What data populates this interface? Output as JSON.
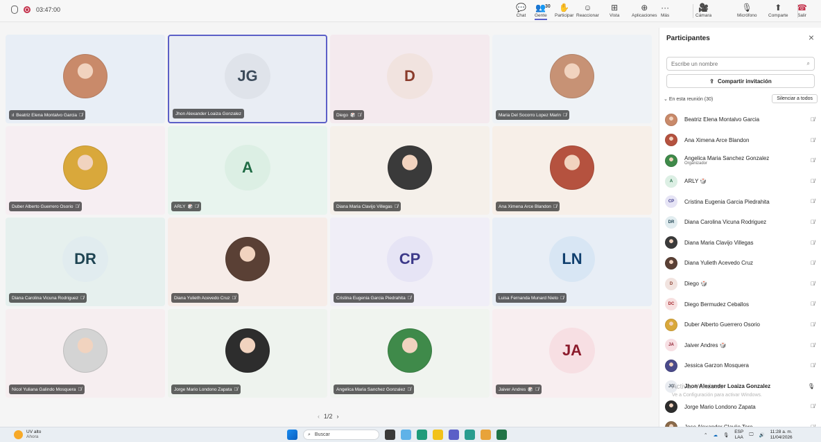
{
  "topbar": {
    "timer": "03:47:00",
    "buttons": [
      {
        "label": "Chat",
        "icon": "chat-icon",
        "glyph": "💬"
      },
      {
        "label": "Gente",
        "icon": "people-icon",
        "glyph": "👥",
        "count": "30"
      },
      {
        "label": "Participar",
        "icon": "raise-hand-icon",
        "glyph": "✋"
      },
      {
        "label": "Reaccionar",
        "icon": "smiley-icon",
        "glyph": "☺"
      },
      {
        "label": "Vista",
        "icon": "grid-view-icon",
        "glyph": "⊞"
      },
      {
        "label": "Aplicaciones",
        "icon": "add-app-icon",
        "glyph": "⊕"
      },
      {
        "label": "Más",
        "icon": "more-icon",
        "glyph": "···"
      },
      {
        "label": "Cámara",
        "icon": "camera-off-icon",
        "glyph": "🎥"
      },
      {
        "label": "Micrófono",
        "icon": "mic-off-icon",
        "glyph": "🎙"
      },
      {
        "label": "Comparte",
        "icon": "share-icon",
        "glyph": "⬆"
      },
      {
        "label": "Salir",
        "icon": "hang-up-icon",
        "glyph": "☎"
      }
    ]
  },
  "stage": {
    "tiles": [
      {
        "name": "Beatriz Elena Montalvo Garcia",
        "initials": "",
        "photo_color": "#c98a6a",
        "bg": "#e8eef6",
        "speaking": true,
        "muted": true
      },
      {
        "name": "Jhon Alexander Loaiza Gonzalez",
        "initials": "JG",
        "avatar_bg": "#dfe3ea",
        "avatar_fg": "#3b4a5a",
        "bg": "#e9edf4",
        "selected": true,
        "muted": false
      },
      {
        "name": "Diego",
        "initials": "D",
        "avatar_bg": "#f1e3df",
        "avatar_fg": "#8a3c2c",
        "bg": "#f4eaee",
        "hand": true,
        "muted": true
      },
      {
        "name": "Maria Del Socorro Lopez Marin",
        "initials": "",
        "photo_color": "#c79275",
        "bg": "#eef2f6",
        "muted": true
      },
      {
        "name": "Duber Alberto Guerrero Osorio",
        "initials": "",
        "photo_color": "#d9a83b",
        "bg": "#f6eef2",
        "muted": true
      },
      {
        "name": "ARLY",
        "initials": "A",
        "avatar_bg": "#dcefe4",
        "avatar_fg": "#1f6b44",
        "bg": "#e8f4ee",
        "hand": true,
        "muted": true
      },
      {
        "name": "Diana Maria Clavijo Villegas",
        "initials": "",
        "photo_color": "#3a3a3a",
        "bg": "#f5f0ea",
        "muted": true
      },
      {
        "name": "Ana Ximena Arce Blandon",
        "initials": "",
        "photo_color": "#b5523f",
        "bg": "#f7efe8",
        "muted": true
      },
      {
        "name": "Diana Carolina Vicuna Rodriguez",
        "initials": "DR",
        "avatar_bg": "#e1ecef",
        "avatar_fg": "#1e4452",
        "bg": "#e6f0ee",
        "muted": true
      },
      {
        "name": "Diana Yulieth Acevedo Cruz",
        "initials": "",
        "photo_color": "#5a4035",
        "bg": "#f6ece8",
        "muted": true
      },
      {
        "name": "Cristina Eugenia Garcia Piedrahita",
        "initials": "CP",
        "avatar_bg": "#e6e4f5",
        "avatar_fg": "#3d3a8a",
        "bg": "#f0eef7",
        "muted": true
      },
      {
        "name": "Luisa Fernanda Munard Nieto",
        "initials": "LN",
        "avatar_bg": "#d8e6f4",
        "avatar_fg": "#0f3f6e",
        "bg": "#e8eef6",
        "muted": true
      },
      {
        "name": "Nicol Yuliana Galindo Mosquera",
        "initials": "",
        "photo_color": "#d4d4d4",
        "bg": "#f6eef0",
        "muted": true
      },
      {
        "name": "Jorge Mario Londono Zapata",
        "initials": "",
        "photo_color": "#2d2d2d",
        "bg": "#eef3ee",
        "muted": true
      },
      {
        "name": "Angelica Maria Sanchez Gonzalez",
        "initials": "",
        "photo_color": "#3f8a4a",
        "bg": "#f0f4ef",
        "muted": true
      },
      {
        "name": "Jaiver Andres",
        "initials": "JA",
        "avatar_bg": "#f7dfe3",
        "avatar_fg": "#8b1a2b",
        "bg": "#f8eef0",
        "hand": true,
        "muted": true
      }
    ],
    "pager": "1/2"
  },
  "panel": {
    "title": "Participantes",
    "search_placeholder": "Escribe un nombre",
    "invite_label": "Compartir invitación",
    "section_label": "En esta reunión (30)",
    "mute_all_label": "Silenciar a todos",
    "participants": [
      {
        "name": "Beatriz Elena Montalvo Garcia",
        "initials": "",
        "color": "#c98a6a"
      },
      {
        "name": "Ana Ximena Arce Blandon",
        "initials": "",
        "color": "#b5523f"
      },
      {
        "name": "Angelica Maria Sanchez Gonzalez",
        "role": "Organizador",
        "initials": "",
        "color": "#3f8a4a"
      },
      {
        "name": "ARLY 🎲",
        "initials": "A",
        "color": "#dcefe4",
        "fg": "#1f6b44"
      },
      {
        "name": "Cristina Eugenia Garcia Piedrahita",
        "initials": "CP",
        "color": "#e6e4f5",
        "fg": "#3d3a8a"
      },
      {
        "name": "Diana Carolina Vicuna Rodriguez",
        "initials": "DR",
        "color": "#e1ecef",
        "fg": "#1e4452"
      },
      {
        "name": "Diana Maria Clavijo Villegas",
        "initials": "",
        "color": "#3a3a3a"
      },
      {
        "name": "Diana Yulieth Acevedo Cruz",
        "initials": "",
        "color": "#5a4035"
      },
      {
        "name": "Diego 🎲",
        "initials": "D",
        "color": "#f1e3df",
        "fg": "#8a3c2c"
      },
      {
        "name": "Diego Bermudez Ceballos",
        "initials": "DC",
        "color": "#f7e0e0",
        "fg": "#a4262c"
      },
      {
        "name": "Duber Alberto Guerrero Osorio",
        "initials": "",
        "color": "#d9a83b"
      },
      {
        "name": "Jaiver Andres 🎲",
        "initials": "JA",
        "color": "#f7dfe3",
        "fg": "#8b1a2b"
      },
      {
        "name": "Jessica Garzon Mosquera",
        "initials": "",
        "color": "#4a4a8a"
      },
      {
        "name": "Jhon Alexander Loaiza Gonzalez",
        "initials": "JG",
        "color": "#e9ecf1",
        "fg": "#3b4a5a",
        "bold": true,
        "mic_on": true
      },
      {
        "name": "Jorge Mario Londono Zapata",
        "initials": "",
        "color": "#2d2d2d"
      },
      {
        "name": "Jose Alexander Clavijo Toro",
        "initials": "",
        "color": "#8a6a4a"
      }
    ],
    "watermark_title": "Activar Windows",
    "watermark_sub": "Ve a Configuración para activar Windows."
  },
  "taskbar": {
    "weather_title": "UV alto",
    "weather_sub": "Ahora",
    "search_label": "Buscar",
    "lang_top": "ESP",
    "lang_bottom": "LAA",
    "time": "11:28 a. m.",
    "date": "11/04/2026"
  }
}
